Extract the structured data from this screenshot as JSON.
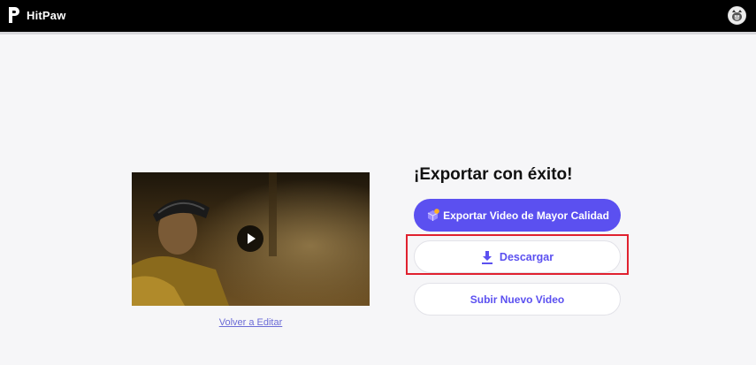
{
  "app": {
    "brand": "HitPaw"
  },
  "header": {
    "avatar_icon": "user-avatar-icon"
  },
  "video": {
    "play_icon": "play-icon"
  },
  "actions": {
    "back_link": "Volver a Editar",
    "success_title": "¡Exportar con éxito!",
    "export_hq_label": "Exportar Video de Mayor Calidad",
    "download_label": "Descargar",
    "upload_label": "Subir Nuevo Video"
  },
  "colors": {
    "accent": "#5b50f0",
    "highlight": "#e0212f",
    "topbar": "#000000",
    "background": "#f6f6f8"
  }
}
